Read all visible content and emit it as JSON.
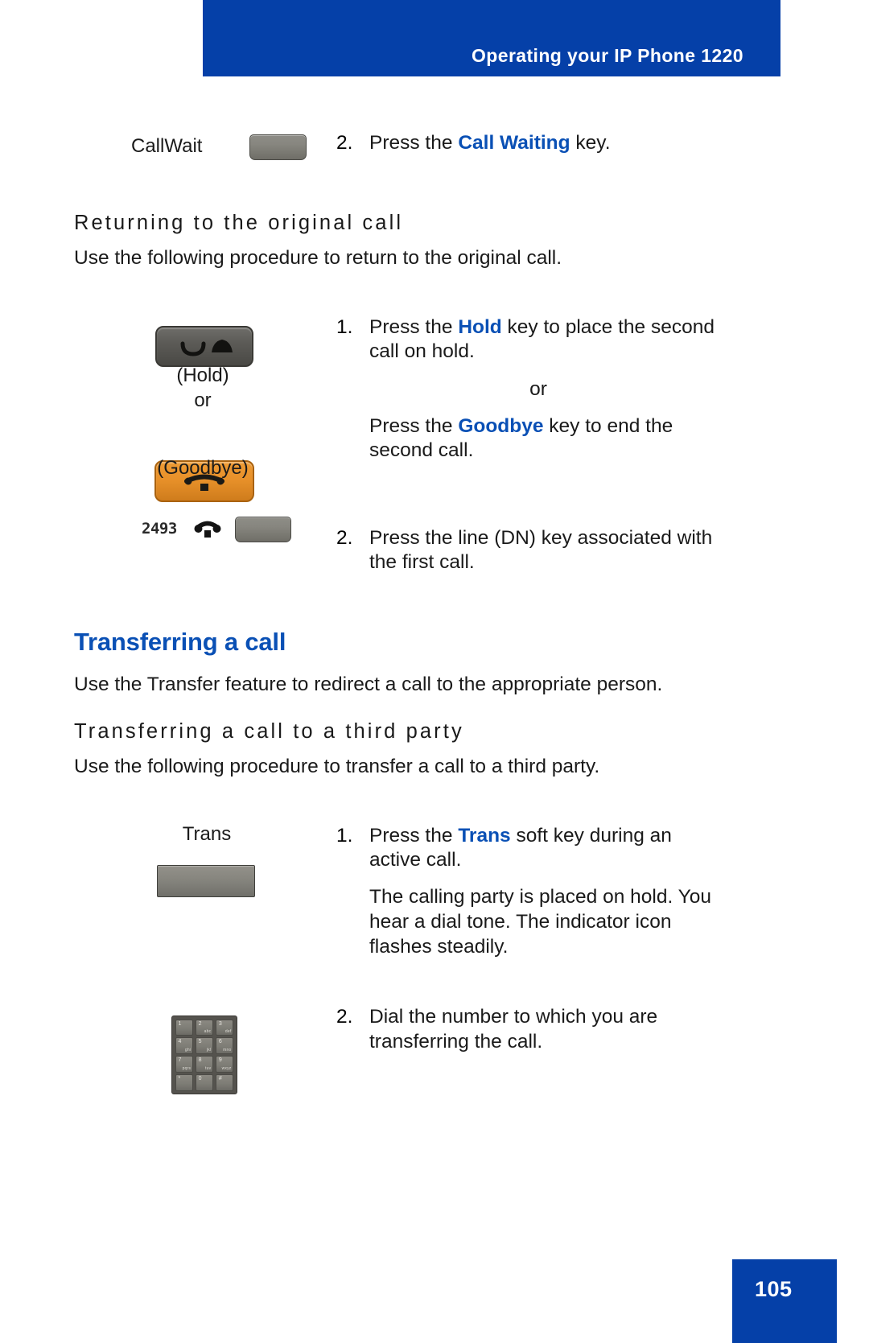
{
  "header": {
    "title": "Operating your IP Phone 1220",
    "banner_color": "#0540a8"
  },
  "callwait_step": {
    "key_label": "CallWait",
    "number": "2.",
    "text_before": "Press the ",
    "keyword": "Call Waiting",
    "text_after": " key."
  },
  "section_returning": {
    "heading": "Returning to the original call",
    "intro": "Use the following procedure to return to the original call.",
    "hold_caption": "(Hold)",
    "or_caption": "or",
    "goodbye_caption": "(Goodbye)",
    "step1": {
      "number": "1.",
      "line1_before": "Press the ",
      "line1_keyword": "Hold",
      "line1_after": " key to place the second",
      "line2": "call on hold.",
      "or_text": "or",
      "alt_before": "Press the ",
      "alt_keyword": "Goodbye",
      "alt_after": " key to end the",
      "alt_line2": "second call."
    },
    "step2": {
      "number": "2.",
      "line1": "Press the line (DN) key associated with",
      "line2": "the first call.",
      "dn_number": "2493"
    }
  },
  "section_transferring": {
    "heading": "Transferring a call",
    "intro": "Use the Transfer feature to redirect a call to the appropriate person.",
    "subheading": "Transferring a call to a third party",
    "sub_intro": "Use the following procedure to transfer a call to a third party.",
    "trans_key_label": "Trans",
    "step1": {
      "number": "1.",
      "line1_before": "Press the ",
      "line1_keyword": "Trans",
      "line1_after": " soft key during an",
      "line2": "active call.",
      "para_line1": "The calling party is placed on hold. You",
      "para_line2": "hear a dial tone. The indicator icon",
      "para_line3": "flashes steadily."
    },
    "step2": {
      "number": "2.",
      "line1": "Dial the number to which you are",
      "line2": "transferring the call."
    }
  },
  "keypad": {
    "keys": [
      {
        "num": "1",
        "alpha": ""
      },
      {
        "num": "2",
        "alpha": "abc"
      },
      {
        "num": "3",
        "alpha": "def"
      },
      {
        "num": "4",
        "alpha": "ghi"
      },
      {
        "num": "5",
        "alpha": "jkl"
      },
      {
        "num": "6",
        "alpha": "mno"
      },
      {
        "num": "7",
        "alpha": "pqrs"
      },
      {
        "num": "8",
        "alpha": "tuv"
      },
      {
        "num": "9",
        "alpha": "wxyz"
      },
      {
        "num": "*",
        "alpha": ""
      },
      {
        "num": "0",
        "alpha": ""
      },
      {
        "num": "#",
        "alpha": ""
      }
    ]
  },
  "footer": {
    "page_number": "105"
  },
  "colors": {
    "accent_blue": "#0a50b5",
    "banner_blue": "#0540a8",
    "goodbye_orange": "#e8912a",
    "key_gray": "#87867f"
  }
}
